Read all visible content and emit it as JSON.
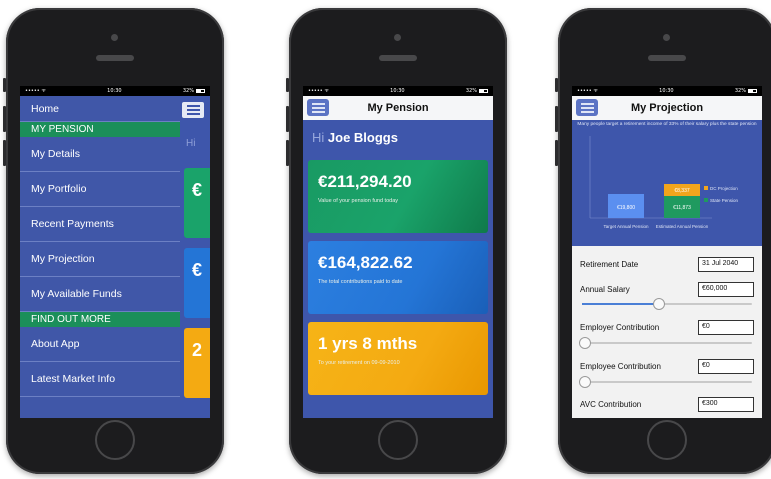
{
  "status_bar": {
    "carrier": "••••• ᯤ",
    "time": "10:30",
    "battery": "32%"
  },
  "menu_phone": {
    "items": [
      {
        "label": "Home",
        "type": "item"
      },
      {
        "label": "MY PENSION",
        "type": "section"
      },
      {
        "label": "My Details",
        "type": "item"
      },
      {
        "label": "My Portfolio",
        "type": "item"
      },
      {
        "label": "Recent Payments",
        "type": "item"
      },
      {
        "label": "My Projection",
        "type": "item"
      },
      {
        "label": "My Available Funds",
        "type": "item"
      },
      {
        "label": "FIND OUT MORE",
        "type": "section"
      },
      {
        "label": "About App",
        "type": "item"
      },
      {
        "label": "Latest Market Info",
        "type": "item"
      }
    ],
    "peek_greeting": "Hi",
    "peek_tiles": [
      "€",
      "€",
      "2"
    ]
  },
  "pension_phone": {
    "title": "My Pension",
    "greeting_prefix": "Hi",
    "user_name": "Joe Bloggs",
    "cards": [
      {
        "amount": "€211,294.20",
        "caption": "Value of your pension fund today",
        "color": "green"
      },
      {
        "amount": "€164,822.62",
        "caption": "The total contributions paid to date",
        "color": "blue"
      },
      {
        "amount": "1 yrs 8 mths",
        "caption": "To your retirement on 09-09-2010",
        "color": "orange"
      }
    ]
  },
  "projection_phone": {
    "title": "My Projection",
    "banner": "Many people target a retirement income of 33% of their salary plus the state pension",
    "chart": {
      "bars": [
        {
          "label": "€19,800",
          "category": "Target Annual Pension",
          "color": "#5b8ff0"
        },
        {
          "label": "€11,873",
          "category": "Estimated Annual Pension",
          "color": "#1f9a5f"
        },
        {
          "label": "€8,337",
          "category": "",
          "color": "#f2a51c"
        }
      ],
      "legend": [
        "DC Projection",
        "State Pension"
      ]
    },
    "fields": [
      {
        "label": "Retirement Date",
        "value": "31 Jul 2040",
        "slider": null
      },
      {
        "label": "Annual Salary",
        "value": "€60,000",
        "slider": 0.45
      },
      {
        "label": "Employer Contribution",
        "value": "€0",
        "slider": 0.0
      },
      {
        "label": "Employee Contribution",
        "value": "€0",
        "slider": 0.0
      },
      {
        "label": "AVC Contribution",
        "value": "€300",
        "slider": null
      }
    ]
  }
}
